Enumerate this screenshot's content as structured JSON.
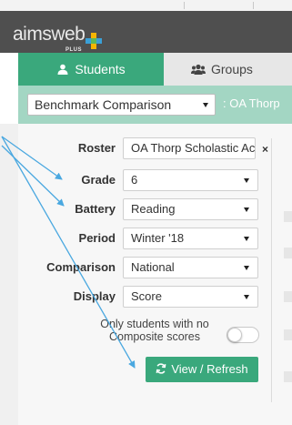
{
  "logo": {
    "brand": "aimsweb",
    "sub": "PLUS"
  },
  "tabs": [
    {
      "label": "Students",
      "icon": "user-icon",
      "active": true
    },
    {
      "label": "Groups",
      "icon": "group-icon",
      "active": false
    }
  ],
  "report_select": {
    "value": "Benchmark Comparison"
  },
  "breadcrumb_suffix": ": OA Thorp",
  "filters": {
    "roster": {
      "label": "Roster",
      "value": "OA Thorp Scholastic Ac"
    },
    "grade": {
      "label": "Grade",
      "value": "6"
    },
    "battery": {
      "label": "Battery",
      "value": "Reading"
    },
    "period": {
      "label": "Period",
      "value": "Winter '18"
    },
    "comparison": {
      "label": "Comparison",
      "value": "National"
    },
    "display": {
      "label": "Display",
      "value": "Score"
    }
  },
  "remove_roster": "×",
  "toggle": {
    "label_line1": "Only students with no",
    "label_line2": "Composite scores",
    "on": false
  },
  "refresh_button": {
    "label": "View / Refresh",
    "icon": "refresh-icon"
  },
  "colors": {
    "accent": "#3aa87c",
    "header": "#4f4f4f",
    "bar": "#a3d6c3",
    "annotation_arrow": "#4aa8e0"
  }
}
